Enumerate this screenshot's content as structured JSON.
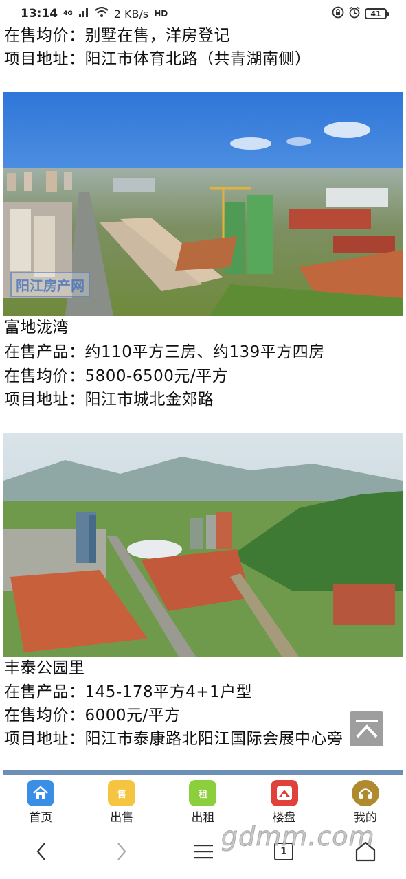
{
  "status_bar": {
    "time": "13:14",
    "network_type": "4G",
    "speed": "2 KB/s",
    "hd": "HD",
    "battery": "41"
  },
  "listings": [
    {
      "price_line_partial": "在售均价：别墅在售，洋房登记",
      "address_line": "项目地址：阳江市体育北路（共青湖南侧）"
    },
    {
      "name": "富地泷湾",
      "products_line": "在售产品：约110平方三房、约139平方四房",
      "price_line": "在售均价：5800-6500元/平方",
      "address_line": "项目地址：阳江市城北金郊路",
      "photo_watermark": "阳江房产网"
    },
    {
      "name": "丰泰公园里",
      "products_line": "在售产品：145-178平方4+1户型",
      "price_line": "在售均价：6000元/平方",
      "address_line": "项目地址：阳江市泰康路北阳江国际会展中心旁"
    }
  ],
  "tabbar": {
    "items": [
      {
        "label": "首页",
        "icon": "home-icon",
        "color": "#3a8ee6"
      },
      {
        "label": "出售",
        "icon_text": "售",
        "icon": "sale-bag-icon",
        "color": "#f5c542"
      },
      {
        "label": "出租",
        "icon_text": "租",
        "icon": "rent-badge-icon",
        "color": "#8ccf3c"
      },
      {
        "label": "楼盘",
        "icon": "building-icon",
        "color": "#e0413a"
      },
      {
        "label": "我的",
        "icon": "headset-icon",
        "color": "#b08a2e"
      }
    ]
  },
  "navbar": {
    "tab_count": "1",
    "site_watermark": "gdmm.com"
  }
}
